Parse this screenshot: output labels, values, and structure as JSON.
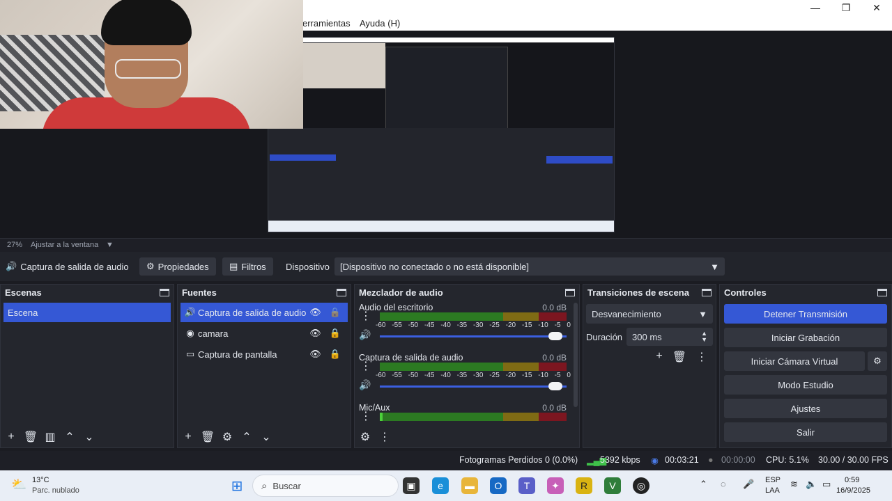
{
  "window": {
    "minimize": "—",
    "maximize": "❐",
    "close": "✕"
  },
  "menu": {
    "tools": "erramientas",
    "help": "Ayuda (H)"
  },
  "preview": {
    "zoom": "27%",
    "fit_label": "Ajustar a la ventana"
  },
  "context": {
    "source_name": "Captura de salida de audio",
    "properties": "Propiedades",
    "filters": "Filtros",
    "device_label": "Dispositivo",
    "device_value": "[Dispositivo no conectado o no está disponible]"
  },
  "scenes": {
    "title": "Escenas",
    "items": [
      "Escena"
    ]
  },
  "sources": {
    "title": "Fuentes",
    "items": [
      "Captura de salida de audio",
      "camara",
      "Captura de pantalla"
    ]
  },
  "mixer": {
    "title": "Mezclador de audio",
    "ticks": [
      "-60",
      "-55",
      "-50",
      "-45",
      "-40",
      "-35",
      "-30",
      "-25",
      "-20",
      "-15",
      "-10",
      "-5",
      "0"
    ],
    "channels": [
      {
        "name": "Audio del escritorio",
        "db": "0.0 dB"
      },
      {
        "name": "Captura de salida de audio",
        "db": "0.0 dB"
      },
      {
        "name": "Mic/Aux",
        "db": "0.0 dB"
      }
    ]
  },
  "transitions": {
    "title": "Transiciones de escena",
    "selected": "Desvanecimiento",
    "duration_label": "Duración",
    "duration_value": "300 ms"
  },
  "controls": {
    "title": "Controles",
    "stop_stream": "Detener Transmisión",
    "start_record": "Iniciar Grabación",
    "virtual_cam": "Iniciar Cámara Virtual",
    "studio_mode": "Modo Estudio",
    "settings": "Ajustes",
    "exit": "Salir"
  },
  "status": {
    "dropped": "Fotogramas Perdidos 0 (0.0%)",
    "bitrate": "5392 kbps",
    "stream_time": "00:03:21",
    "rec_time": "00:00:00",
    "cpu": "CPU: 5.1%",
    "fps": "30.00 / 30.00 FPS"
  },
  "taskbar": {
    "temp": "13°C",
    "weather": "Parc. nublado",
    "search": "Buscar",
    "lang1": "ESP",
    "lang2": "LAA",
    "time": "0:59",
    "date": "16/9/2025"
  },
  "colors": {
    "accent": "#3558d5",
    "panel": "#24262d",
    "meter_green": "#2c7a22",
    "meter_yellow": "#7f6b14",
    "meter_red": "#7c1620"
  }
}
